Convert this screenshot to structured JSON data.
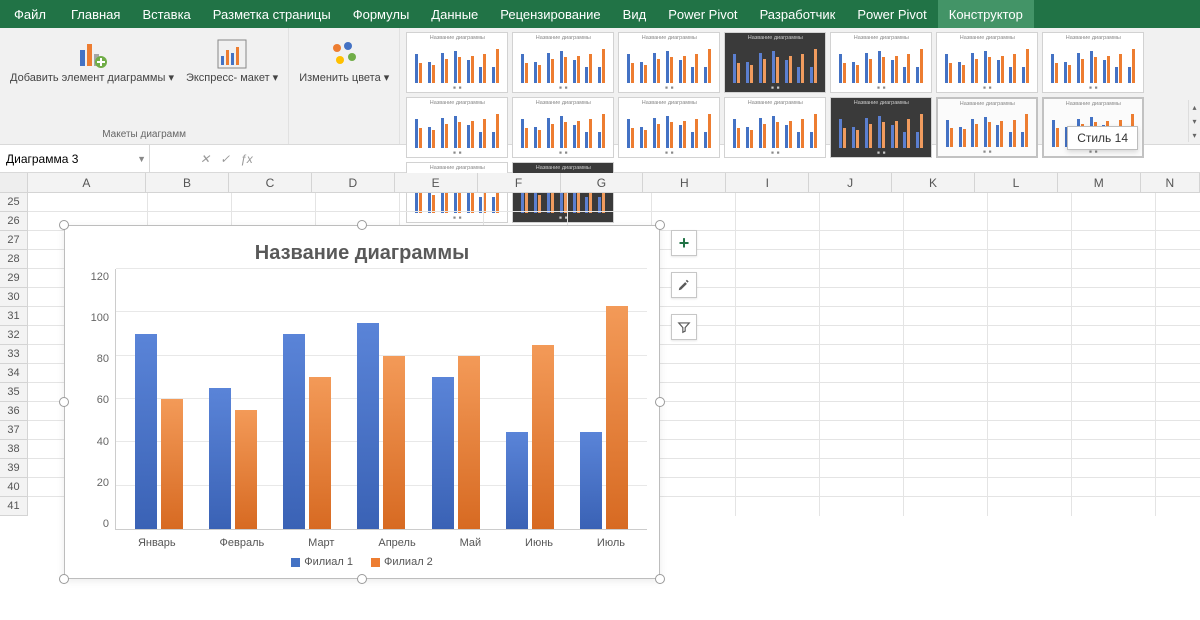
{
  "ribbon_tabs": [
    "Файл",
    "Главная",
    "Вставка",
    "Разметка страницы",
    "Формулы",
    "Данные",
    "Рецензирование",
    "Вид",
    "Power Pivot",
    "Разработчик",
    "Power Pivot",
    "Конструктор"
  ],
  "ribbon_active_index": 11,
  "groups": {
    "layouts_label": "Макеты диаграмм",
    "add_element": "Добавить элемент\nдиаграммы ▾",
    "quick_layout": "Экспресс-\nмакет ▾",
    "change_colors": "Изменить\nцвета ▾"
  },
  "gallery_tooltip": "Стиль 14",
  "gallery_selected": 13,
  "gallery_dark_indices": [
    3,
    11,
    15
  ],
  "gallery_count": 16,
  "namebox": "Диаграмма 3",
  "fx_value": "",
  "columns": [
    {
      "l": "A",
      "w": 120
    },
    {
      "l": "B",
      "w": 84
    },
    {
      "l": "C",
      "w": 84
    },
    {
      "l": "D",
      "w": 84
    },
    {
      "l": "E",
      "w": 84
    },
    {
      "l": "F",
      "w": 84
    },
    {
      "l": "G",
      "w": 84
    },
    {
      "l": "H",
      "w": 84
    },
    {
      "l": "I",
      "w": 84
    },
    {
      "l": "J",
      "w": 84
    },
    {
      "l": "K",
      "w": 84
    },
    {
      "l": "L",
      "w": 84
    },
    {
      "l": "M",
      "w": 84
    },
    {
      "l": "N",
      "w": 60
    }
  ],
  "rows_start": 25,
  "rows_end": 41,
  "chart_data": {
    "type": "bar",
    "title": "Название диаграммы",
    "categories": [
      "Январь",
      "Февраль",
      "Март",
      "Апрель",
      "Май",
      "Июнь",
      "Июль"
    ],
    "series": [
      {
        "name": "Филиал 1",
        "values": [
          90,
          65,
          90,
          95,
          70,
          45,
          45
        ],
        "color": "#4472c4"
      },
      {
        "name": "Филиал 2",
        "values": [
          60,
          55,
          70,
          80,
          80,
          85,
          103
        ],
        "color": "#ed7d31"
      }
    ],
    "ylim": [
      0,
      120
    ],
    "yticks": [
      0,
      20,
      40,
      60,
      80,
      100,
      120
    ],
    "xlabel": "",
    "ylabel": ""
  }
}
